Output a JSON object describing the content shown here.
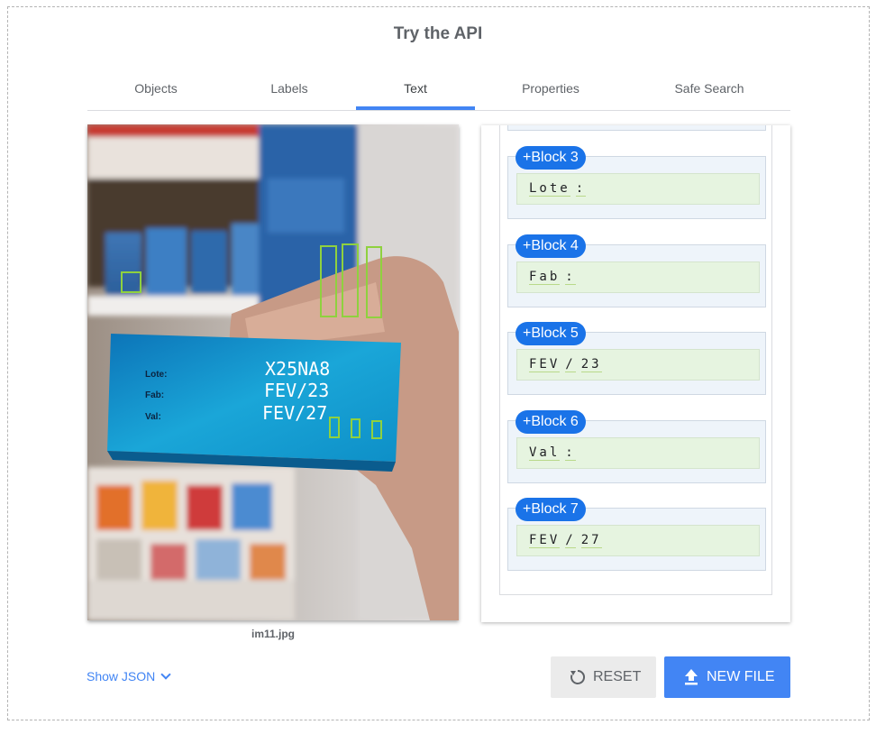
{
  "page": {
    "title": "Try the API"
  },
  "tabs": [
    {
      "label": "Objects"
    },
    {
      "label": "Labels"
    },
    {
      "label": "Text"
    },
    {
      "label": "Properties"
    },
    {
      "label": "Safe Search"
    }
  ],
  "active_tab": "Text",
  "image": {
    "filename": "im11.jpg",
    "box_text": {
      "lote": "Lote:",
      "fab": "Fab:",
      "val": "Val:",
      "line1": "X25NA8",
      "line2": "FEV/23",
      "line3": "FEV/27"
    },
    "box_color": "#0e8fc7",
    "highlight_color": "#8fd13f"
  },
  "blocks": [
    {
      "tag": "+Block 3",
      "words": [
        "Lote",
        ":"
      ]
    },
    {
      "tag": "+Block 4",
      "words": [
        "Fab",
        ":"
      ]
    },
    {
      "tag": "+Block 5",
      "words": [
        "FEV",
        "/",
        "23"
      ]
    },
    {
      "tag": "+Block 6",
      "words": [
        "Val",
        ":"
      ]
    },
    {
      "tag": "+Block 7",
      "words": [
        "FEV",
        "/",
        "27"
      ]
    }
  ],
  "footer": {
    "show_json": "Show JSON",
    "reset": "RESET",
    "new_file": "NEW FILE"
  },
  "colors": {
    "accent": "#4285f4",
    "tag": "#1a73e8",
    "text_bg": "#e6f4e0",
    "block_bg": "#eef4fa"
  }
}
